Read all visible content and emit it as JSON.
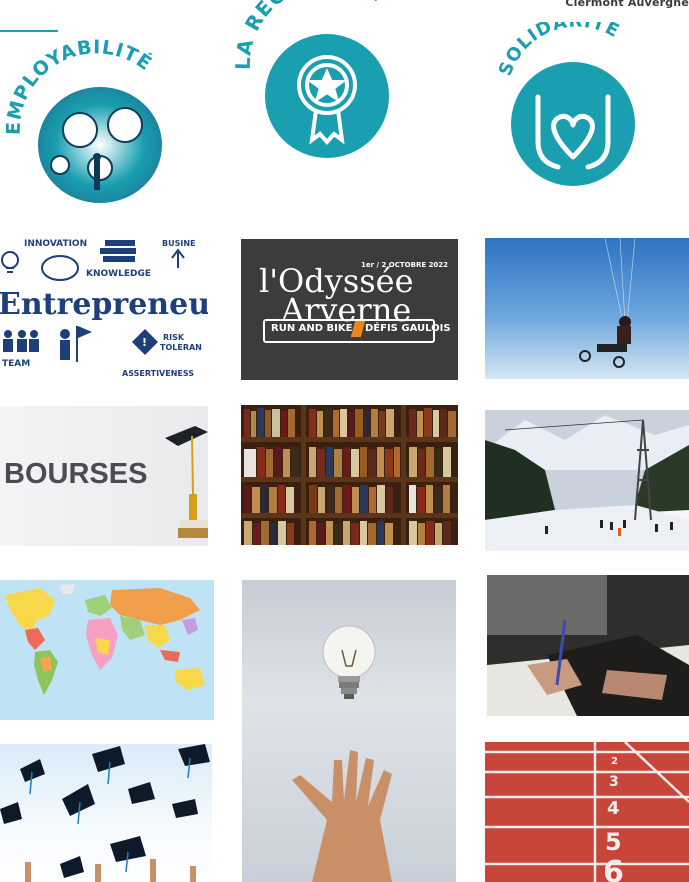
{
  "header": {
    "brand_text": "Clermont Auvergne"
  },
  "badges": [
    {
      "label": "EMPLOYABILITÉ",
      "icon": "gears-people-icon"
    },
    {
      "label": "LA RECHERCHE",
      "icon": "rosette-star-icon"
    },
    {
      "label": "SOLIDARITÉ",
      "icon": "hands-heart-icon"
    }
  ],
  "entrepreneur": {
    "title": "Entrepreneur",
    "words": {
      "innovation": "INNOVATION",
      "knowledge": "KNOWLEDGE",
      "business": "BUSINE",
      "risk": "RISK",
      "tolerance": "TOLERAN",
      "team": "TEAM",
      "assertiveness": "ASSERTIVENESS"
    }
  },
  "odyssee": {
    "date": "1er / 2 OCTOBRE 2022",
    "line1": "l'Odyssée",
    "line2": "Arverne",
    "tagline_left": "RUN AND BIKE",
    "tagline_right": "DÉFIS GAULOIS"
  },
  "bourses": {
    "label": "BOURSES"
  },
  "colors": {
    "teal": "#1a9fb0",
    "dark": "#3a3d3b",
    "track_red": "#c8453a"
  },
  "track": {
    "lane_numbers": [
      "2",
      "3",
      "4",
      "5",
      "6"
    ]
  }
}
